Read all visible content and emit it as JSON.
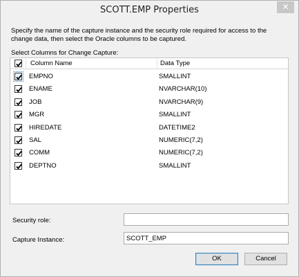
{
  "window": {
    "title": "SCOTT.EMP Properties",
    "close_glyph": "✕"
  },
  "instructions": "Specify the name of the capture instance and the security role required for access to the change data, then select the Oracle columns to be captured.",
  "columns_section_label": "Select Columns for Change Capture:",
  "grid": {
    "header": {
      "select_all_checked": true,
      "column_name": "Column Name",
      "data_type": "Data Type"
    },
    "rows": [
      {
        "checked": true,
        "name": "EMPNO",
        "type": "SMALLINT"
      },
      {
        "checked": true,
        "name": "ENAME",
        "type": "NVARCHAR(10)"
      },
      {
        "checked": true,
        "name": "JOB",
        "type": "NVARCHAR(9)"
      },
      {
        "checked": true,
        "name": "MGR",
        "type": "SMALLINT"
      },
      {
        "checked": true,
        "name": "HIREDATE",
        "type": "DATETIME2"
      },
      {
        "checked": true,
        "name": "SAL",
        "type": "NUMERIC(7,2)"
      },
      {
        "checked": true,
        "name": "COMM",
        "type": "NUMERIC(7,2)"
      },
      {
        "checked": true,
        "name": "DEPTNO",
        "type": "SMALLINT"
      }
    ]
  },
  "security_role": {
    "label": "Security role:",
    "value": ""
  },
  "capture_instance": {
    "label": "Capture Instance:",
    "value": "SCOTT_EMP"
  },
  "buttons": {
    "ok": "OK",
    "cancel": "Cancel"
  },
  "colors": {
    "window_bg": "#f0f0f0",
    "grid_bg": "#ffffff",
    "accent": "#3c7fb1"
  }
}
